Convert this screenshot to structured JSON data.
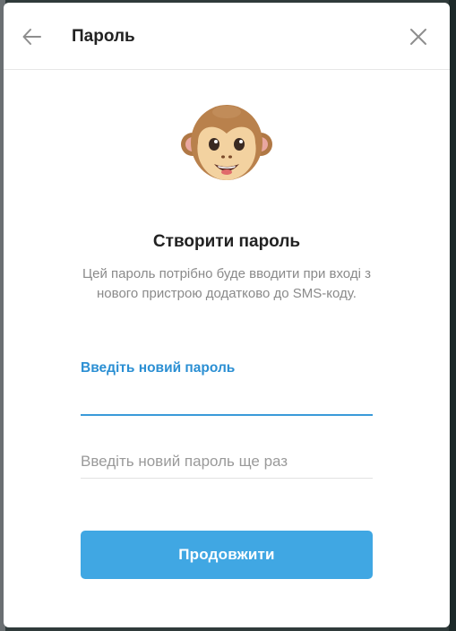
{
  "header": {
    "title": "Пароль",
    "back_icon": "arrow-left-icon",
    "close_icon": "close-icon"
  },
  "illustration": "monkey-emoji",
  "content": {
    "heading": "Створити пароль",
    "description": "Цей пароль потрібно буде вводити при вході з нового пристрою додатково до SMS-коду."
  },
  "form": {
    "new_password_label": "Введіть новий пароль",
    "new_password_value": "",
    "repeat_password_placeholder": "Введіть новий пароль ще раз",
    "repeat_password_value": ""
  },
  "actions": {
    "continue_label": "Продовжити"
  },
  "colors": {
    "accent": "#40a7e3",
    "link": "#2b8fd3"
  }
}
